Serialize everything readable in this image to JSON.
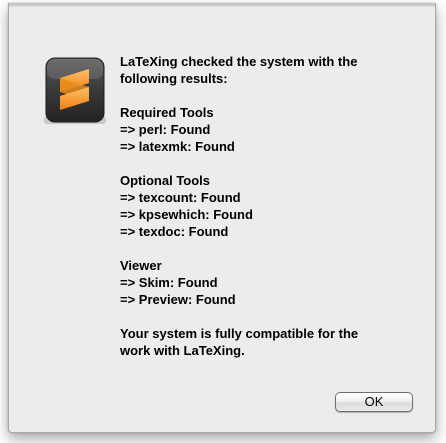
{
  "dialog": {
    "icon": "sublime-text-icon",
    "message": {
      "intro": [
        "LaTeXing checked the system with the",
        "following results:"
      ],
      "required": {
        "heading": "Required Tools",
        "items": [
          "=> perl: Found",
          "=> latexmk: Found"
        ]
      },
      "optional": {
        "heading": "Optional Tools",
        "items": [
          "=> texcount: Found",
          "=> kpsewhich: Found",
          "=> texdoc: Found"
        ]
      },
      "viewer": {
        "heading": "Viewer",
        "items": [
          "=> Skim: Found",
          "=> Preview: Found"
        ]
      },
      "conclusion": [
        "Your system is fully compatible for the",
        "work with LaTeXing."
      ]
    },
    "ok_label": "OK",
    "colors": {
      "icon_body": "#3a3a3a",
      "icon_accent": "#f59a2c",
      "window_bg": "#ececec"
    }
  }
}
